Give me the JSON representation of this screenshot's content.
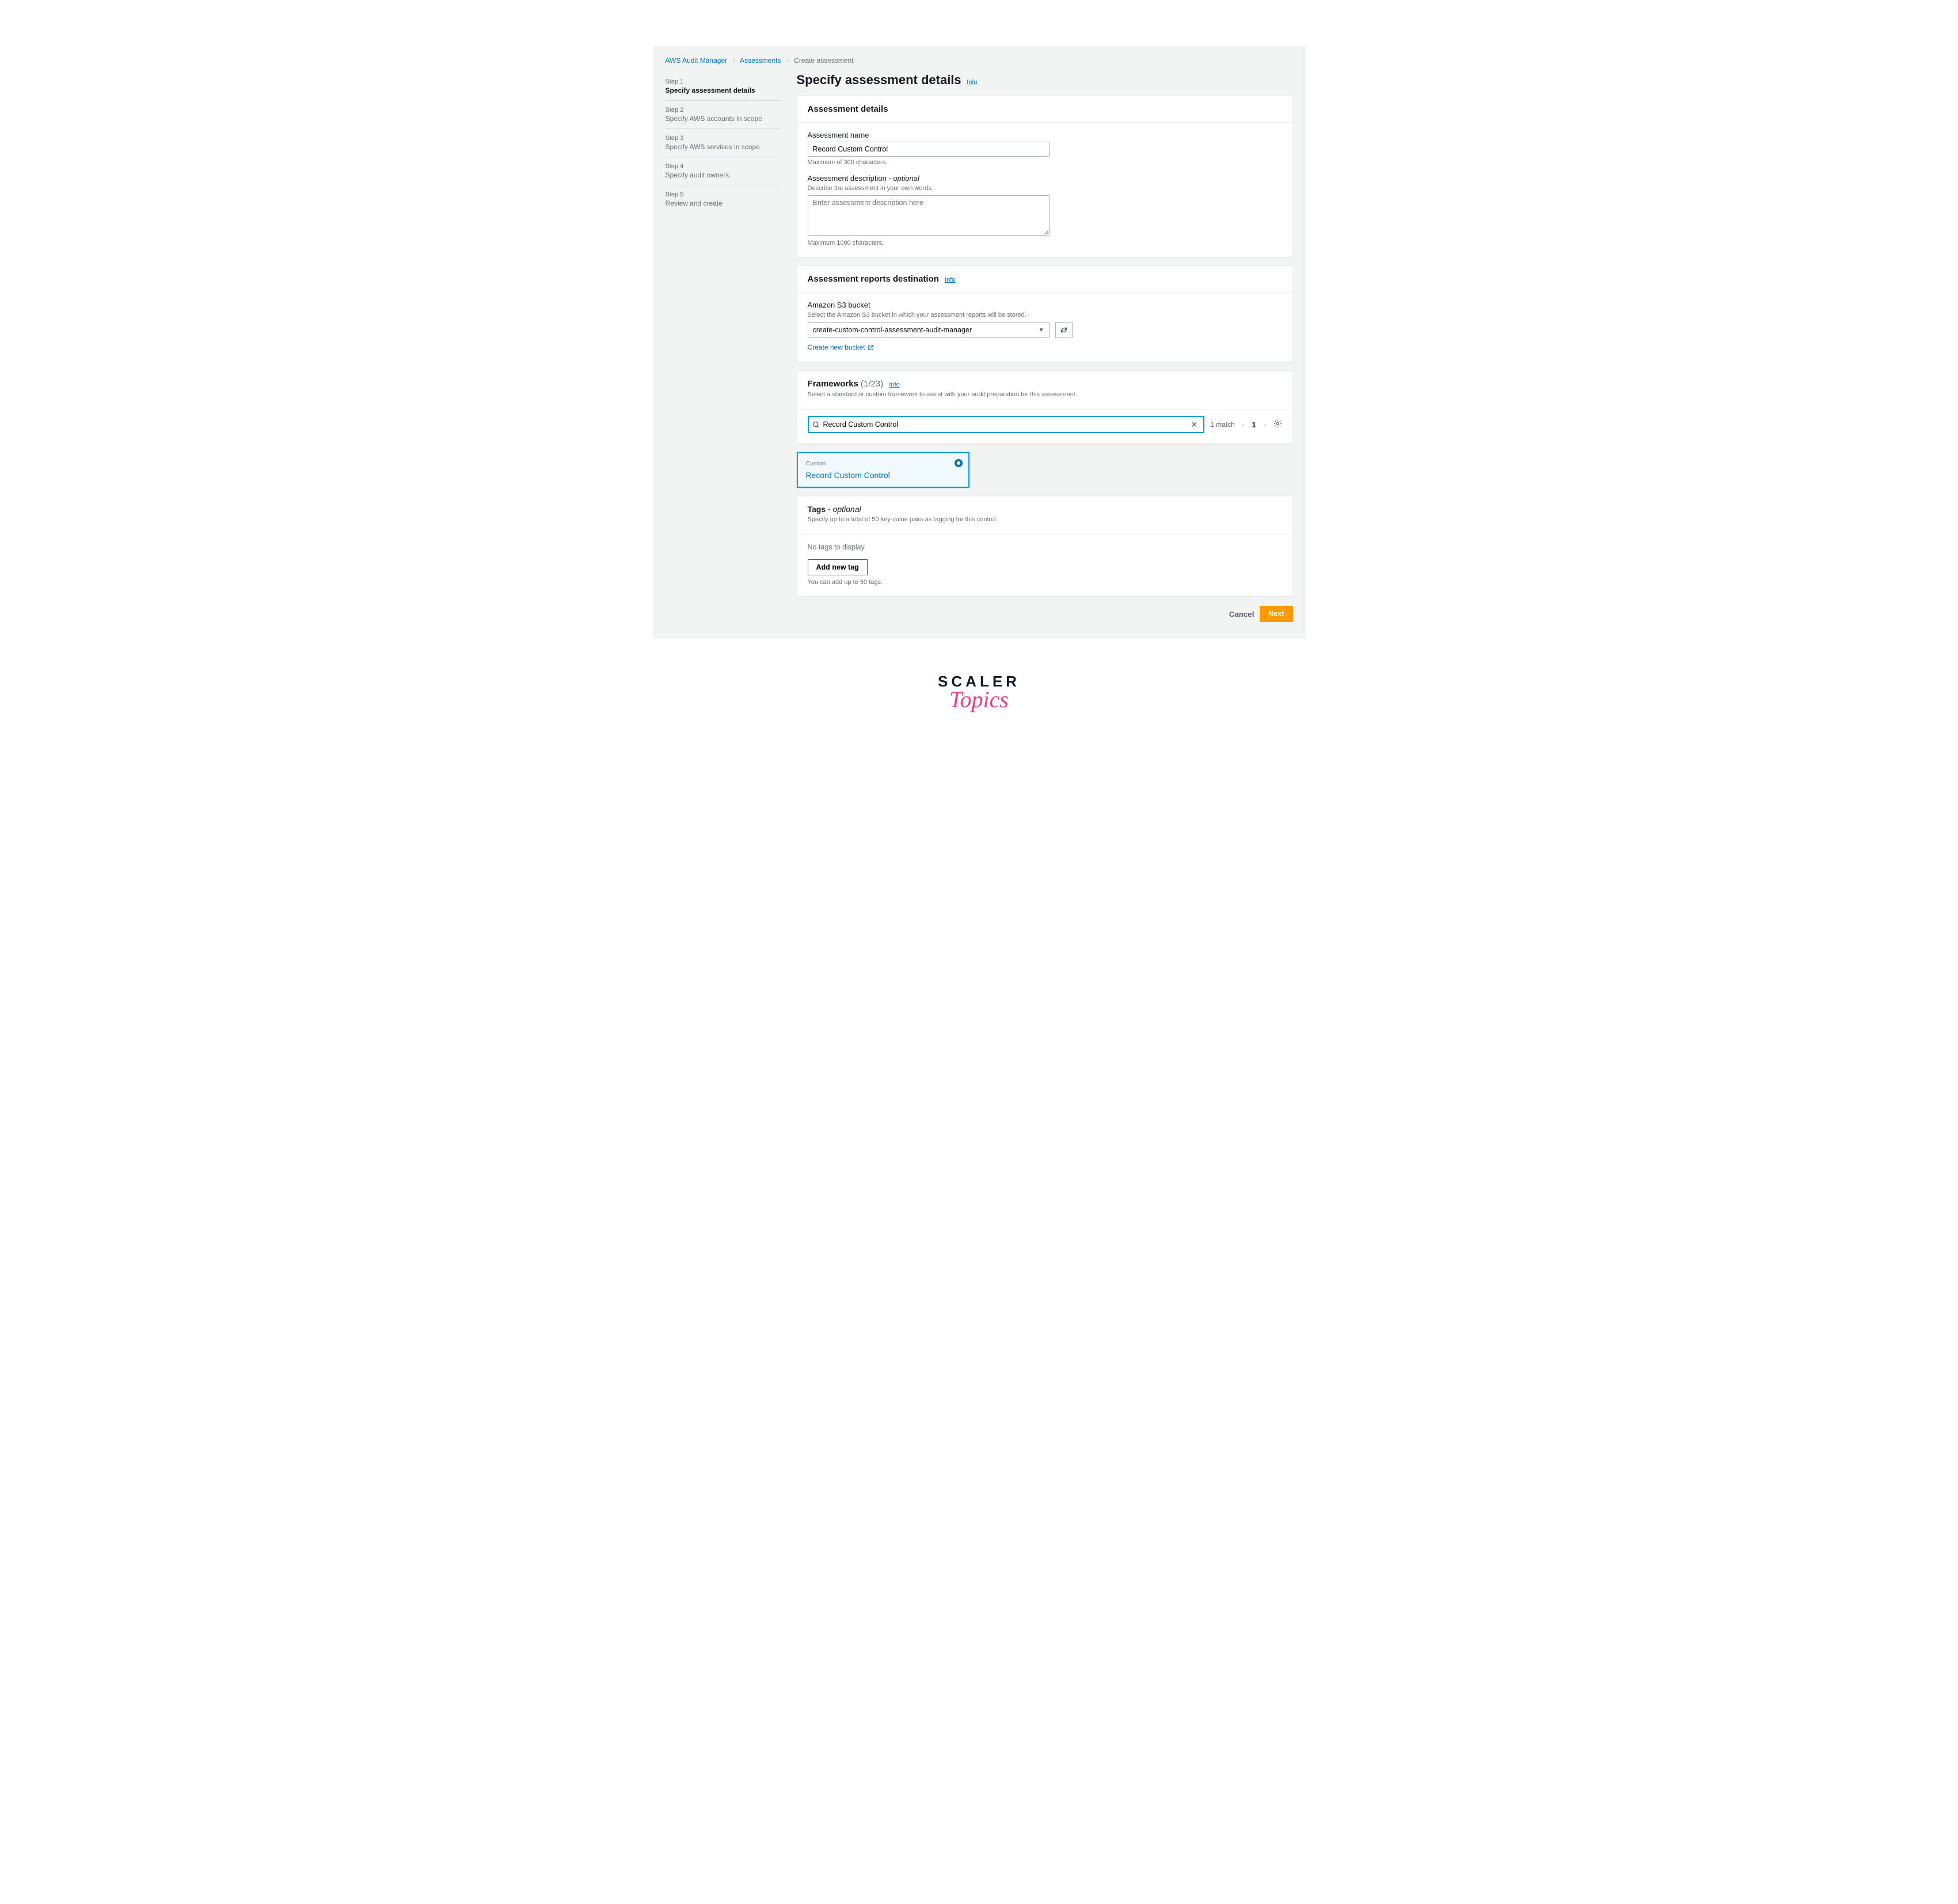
{
  "breadcrumbs": {
    "items": [
      "AWS Audit Manager",
      "Assessments",
      "Create assessment"
    ]
  },
  "sidebar": {
    "steps": [
      {
        "label": "Step 1",
        "title": "Specify assessment details"
      },
      {
        "label": "Step 2",
        "title": "Specify AWS accounts in scope"
      },
      {
        "label": "Step 3",
        "title": "Specify AWS services in scope"
      },
      {
        "label": "Step 4",
        "title": "Specify audit owners"
      },
      {
        "label": "Step 5",
        "title": "Review and create"
      }
    ]
  },
  "page": {
    "title": "Specify assessment details",
    "info": "Info"
  },
  "details": {
    "header": "Assessment details",
    "name_label": "Assessment name",
    "name_value": "Record Custom Control",
    "name_hint": "Maximum of 300 characters.",
    "desc_label": "Assessment description - ",
    "desc_optional": "optional",
    "desc_hint": "Describe the assessment in your own words.",
    "desc_placeholder": "Enter assessment description here",
    "desc_footer": "Maximum 1000 characters."
  },
  "reports": {
    "header": "Assessment reports destination",
    "info": "Info",
    "s3_label": "Amazon S3 bucket",
    "s3_hint": "Select the Amazon S3 bucket in which your assessment reports will be stored.",
    "s3_value": "create-custom-control-assessment-audit-manager",
    "create_bucket": "Create new bucket"
  },
  "frameworks": {
    "header": "Frameworks",
    "count": "(1/23)",
    "info": "Info",
    "hint": "Select a standard or custom framework to assist with your audit preparation for this assessment.",
    "search_value": "Record Custom Control",
    "match_text": "1 match",
    "page": "1",
    "card": {
      "tag": "Custom",
      "name": "Record Custom Control"
    }
  },
  "tags": {
    "header": "Tags - ",
    "optional": "optional",
    "hint": "Specify up to a total of 50 key-value pairs as tagging for this control.",
    "empty": "No tags to display",
    "add_btn": "Add new tag",
    "limit": "You can add up to 50 tags."
  },
  "footer": {
    "cancel": "Cancel",
    "next": "Next"
  },
  "watermark": {
    "line1": "SCALER",
    "line2": "Topics"
  }
}
